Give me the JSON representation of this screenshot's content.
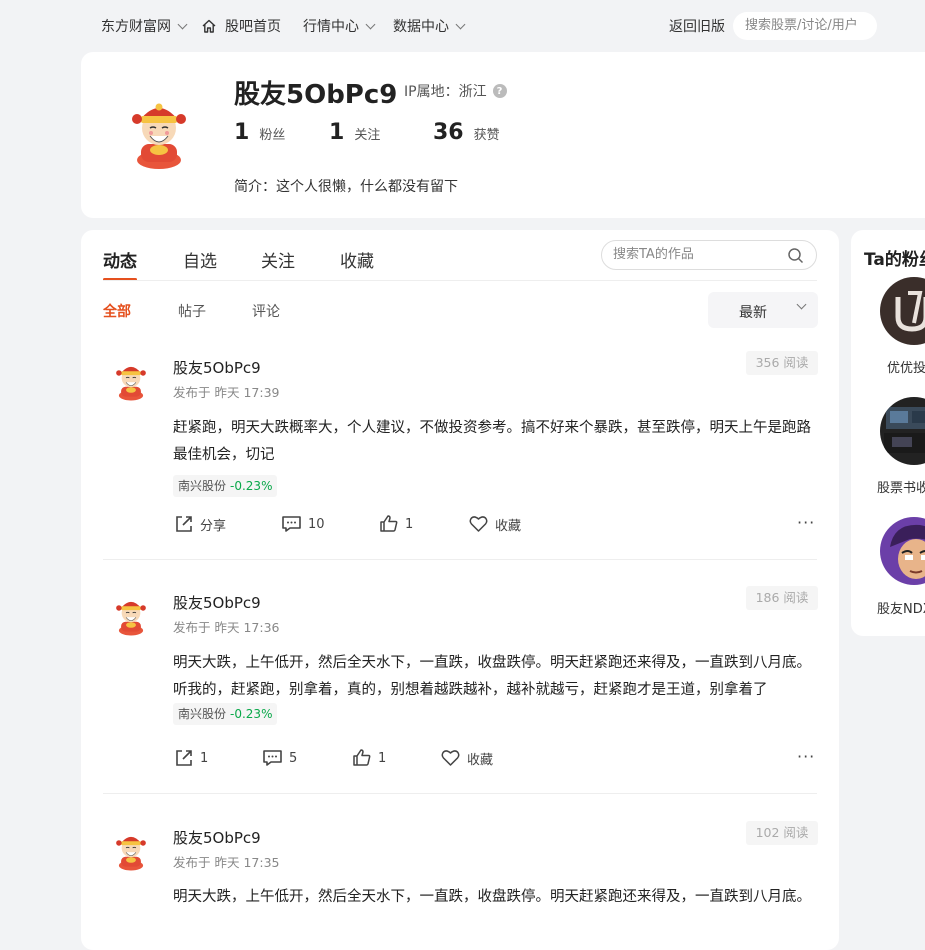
{
  "topnav": {
    "site": "东方财富网",
    "home": "股吧首页",
    "market": "行情中心",
    "data": "数据中心",
    "old_version": "返回旧版",
    "search_placeholder": "搜索股票/讨论/用户"
  },
  "profile": {
    "name": "股友5ObPc9",
    "ip_label": "IP属地：浙江",
    "fans_count": "1",
    "fans_label": "粉丝",
    "follow_count": "1",
    "follow_label": "关注",
    "likes_count": "36",
    "likes_label": "获赞",
    "bio": "简介：这个人很懒，什么都没有留下"
  },
  "tabs": [
    "动态",
    "自选",
    "关注",
    "收藏"
  ],
  "works_search_placeholder": "搜索TA的作品",
  "subtabs": [
    "全部",
    "帖子",
    "评论"
  ],
  "sort": "最新",
  "posts": [
    {
      "author": "股友5ObPc9",
      "time": "发布于 昨天 17:39",
      "reads": "356 阅读",
      "content": "赶紧跑，明天大跌概率大，个人建议，不做投资参考。搞不好来个暴跌，甚至跌停，明天上午是跑路最佳机会，切记",
      "stock": "南兴股份",
      "change": "-0.23%",
      "share": "分享",
      "comments": "10",
      "likes": "1",
      "collect": "收藏"
    },
    {
      "author": "股友5ObPc9",
      "time": "发布于 昨天 17:36",
      "reads": "186 阅读",
      "content": "明天大跌，上午低开，然后全天水下，一直跌，收盘跌停。明天赶紧跑还来得及，一直跌到八月底。听我的，赶紧跑，别拿着，真的，别想着越跌越补，越补就越亏，赶紧跑才是王道，别拿着了",
      "stock": "南兴股份",
      "change": "-0.23%",
      "share": "1",
      "comments": "5",
      "likes": "1",
      "collect": "收藏"
    },
    {
      "author": "股友5ObPc9",
      "time": "发布于 昨天 17:35",
      "reads": "102 阅读",
      "content": "明天大跌，上午低开，然后全天水下，一直跌，收盘跌停。明天赶紧跑还来得及，一直跌到八月底。"
    }
  ],
  "fans_panel": {
    "title": "Ta的粉丝",
    "fans": [
      {
        "name": "优优投资"
      },
      {
        "name": "股票书收藏"
      },
      {
        "name": "股友NDX"
      }
    ]
  },
  "colors": {
    "accent": "#e5501e",
    "price_down": "#0aa84a"
  }
}
